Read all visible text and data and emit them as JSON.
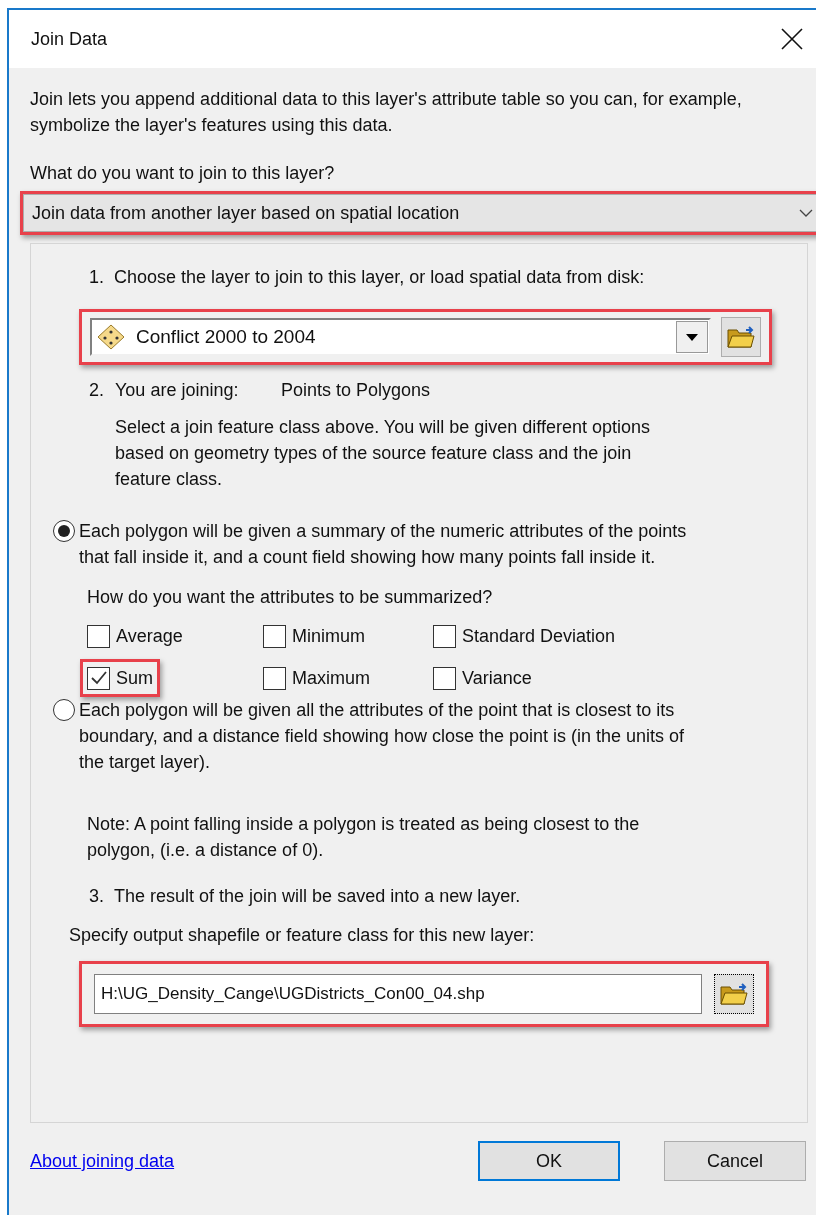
{
  "window": {
    "title": "Join Data"
  },
  "intro": "Join lets you append additional data to this layer's attribute table so you can, for example, symbolize the layer's features using this data.",
  "join_type": {
    "label": "What do you want to join to this layer?",
    "value": "Join data from another layer based on spatial location",
    "highlighted": true
  },
  "step1": {
    "number": "1.",
    "label": "Choose the layer to join to this layer, or load spatial data from disk:",
    "layer": "Conflict 2000 to 2004",
    "highlighted": true
  },
  "step2": {
    "number": "2.",
    "label": "You are joining:",
    "value": "Points to Polygons",
    "description": "Select a join feature class above.  You will be given different options based on geometry types of the source feature class and the join feature class."
  },
  "options": [
    {
      "text": "Each polygon will be given a summary of the numeric attributes of the points that fall inside it, and a count field showing how many points fall inside it.",
      "selected": true
    },
    {
      "text": "Each polygon will be given all the attributes of the point that is closest to its boundary, and a distance field showing how close the point is (in the units of the target layer).",
      "selected": false
    }
  ],
  "summary": {
    "question": "How do you want the attributes to be summarized?",
    "checkboxes": [
      {
        "label": "Average",
        "checked": false,
        "highlighted": false
      },
      {
        "label": "Minimum",
        "checked": false,
        "highlighted": false
      },
      {
        "label": "Standard Deviation",
        "checked": false,
        "highlighted": false
      },
      {
        "label": "Sum",
        "checked": true,
        "highlighted": true
      },
      {
        "label": "Maximum",
        "checked": false,
        "highlighted": false
      },
      {
        "label": "Variance",
        "checked": false,
        "highlighted": false
      }
    ]
  },
  "note": "Note: A point falling inside a polygon is treated as being closest to the polygon, (i.e. a distance of 0).",
  "step3": {
    "number": "3.",
    "label": "The result of the join will be saved into a new layer.",
    "prompt": "Specify output shapefile or feature class for this new layer:",
    "path": "H:\\UG_Density_Cange\\UGDistricts_Con00_04.shp",
    "highlighted": true
  },
  "link": "About joining data",
  "buttons": [
    {
      "label": "OK",
      "default": true
    },
    {
      "label": "Cancel",
      "default": false
    }
  ]
}
